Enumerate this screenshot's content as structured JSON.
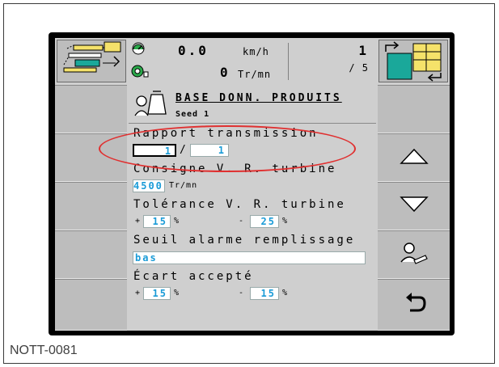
{
  "caption": "NOTT-0081",
  "topbar": {
    "speed_value": "0.0",
    "speed_unit": "km/h",
    "rpm_value": "0",
    "rpm_unit": "Tr/mn",
    "page_current": "1",
    "page_total": "/ 5"
  },
  "header": {
    "title": "BASE DONN. PRODUITS",
    "subtitle": "Seed 1"
  },
  "fields": {
    "ratio_label": "Rapport transmission",
    "ratio_left": "1",
    "ratio_sep": "/",
    "ratio_right": "1",
    "turbine_label": "Consigne V. R. turbine",
    "turbine_value": "4500",
    "turbine_unit": "Tr/mn",
    "tolerance_label": "Tolérance V. R. turbine",
    "tol_plus_sign": "+",
    "tol_plus_value": "15",
    "tol_plus_unit": "%",
    "tol_minus_sign": "-",
    "tol_minus_value": "25",
    "tol_minus_unit": "%",
    "alarm_label": "Seuil alarme remplissage",
    "alarm_value": "bas",
    "ecart_label": "Écart accepté",
    "ecart_plus_sign": "+",
    "ecart_plus_value": "15",
    "ecart_plus_unit": "%",
    "ecart_minus_sign": "-",
    "ecart_minus_value": "15",
    "ecart_minus_unit": "%"
  },
  "colors": {
    "value_text": "#1a9bd7",
    "highlight": "#e03030",
    "screen_bg": "#cfcfcf"
  },
  "icons": [
    "tractor-seeder-icon",
    "speedometer-icon",
    "turbine-icon",
    "screen-switch-icon",
    "product-bag-icon",
    "arrow-up-icon",
    "arrow-down-icon",
    "operator-icon",
    "back-icon"
  ]
}
